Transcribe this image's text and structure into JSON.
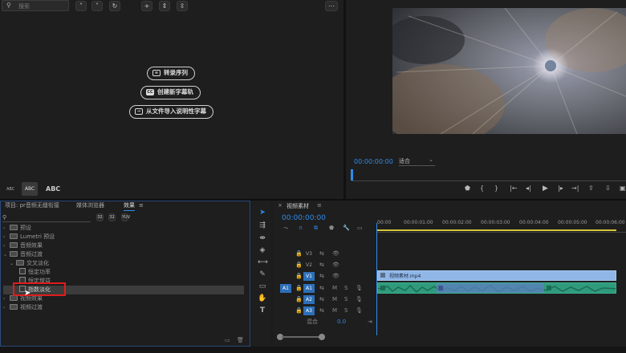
{
  "captions": {
    "search_placeholder": "搜索",
    "btn_to_sequence": "转录序列",
    "btn_new_caption": "创建新字幕轨",
    "btn_import_caption": "从文件导入说明性字幕",
    "cc_icon": "CC",
    "style_abc": [
      "ABC",
      "ABC",
      "ABC"
    ]
  },
  "program": {
    "timecode": "00:00:00:00",
    "zoom": "适合"
  },
  "effects_panel": {
    "tabs": [
      "项目: pr音频无缝衔接",
      "媒体浏览器",
      "效果",
      "≡"
    ],
    "tree": [
      {
        "label": "预设",
        "level": 0
      },
      {
        "label": "Lumetri 预设",
        "level": 0
      },
      {
        "label": "音频效果",
        "level": 0
      },
      {
        "label": "音频过渡",
        "level": 0,
        "open": true
      },
      {
        "label": "交叉淡化",
        "level": 1,
        "open": true
      },
      {
        "label": "恒定功率",
        "level": 2
      },
      {
        "label": "恒定增益",
        "level": 2
      },
      {
        "label": "指数淡化",
        "level": 2,
        "selected": true
      },
      {
        "label": "视频效果",
        "level": 0
      },
      {
        "label": "视频过渡",
        "level": 0
      }
    ]
  },
  "timeline": {
    "tab": "视频素材",
    "timecode": "00:00:00:00",
    "ruler": [
      "00:00",
      "00:00:01:00",
      "00:00:02:00",
      "00:00:03:00",
      "00:00:04:00",
      "00:00:05:00",
      "00:00:06:00"
    ],
    "tracks": [
      "V3",
      "V2",
      "V1",
      "A1",
      "A2",
      "A3"
    ],
    "source_patch": [
      "V1",
      "A1"
    ],
    "mix_label": "混合",
    "mix_value": "0.0",
    "clip_name": "视频素材.mp4",
    "track_letters": {
      "mute": "M",
      "solo": "S"
    }
  },
  "colors": {
    "accent": "#2d8ceb",
    "video_clip": "#8fb6e6",
    "audio_clip": "#2f9b7c",
    "selection": "#e01d1d"
  }
}
